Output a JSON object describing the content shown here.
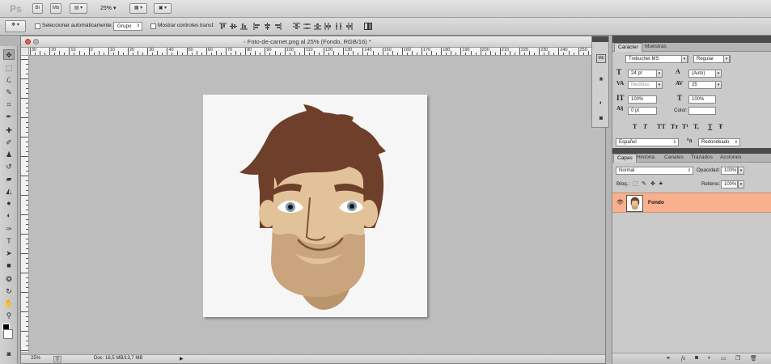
{
  "app": {
    "logo": "Ps"
  },
  "menubar": {
    "btn_br": "Br",
    "btn_mb": "Mb",
    "zoom": "25%"
  },
  "options": {
    "auto_select_label": "Seleccionar automáticamente:",
    "auto_select_value": "Grupo",
    "show_transform_label": "Mostrar controles transf."
  },
  "document": {
    "title": "Foto-de-carnet.png al 25% (Fondo, RGB/16) *",
    "ruler_labels": [
      "30",
      "20",
      "10",
      "0",
      "10",
      "20",
      "30",
      "40",
      "50",
      "60",
      "70",
      "80",
      "90",
      "100",
      "110",
      "120",
      "130",
      "140",
      "150",
      "160",
      "170",
      "180",
      "190",
      "200",
      "210",
      "220",
      "230",
      "240",
      "250"
    ],
    "status_zoom": "25%",
    "status_doc": "Doc: 16,5 MB/13,7 MB"
  },
  "character_panel": {
    "tabs": [
      "Carácter",
      "Muestras"
    ],
    "font_family": "Trebuchet MS",
    "font_style": "Regular",
    "font_size": "24 pt",
    "leading": "(Auto)",
    "kerning": "Medidas",
    "tracking": "25",
    "vscale": "100%",
    "hscale": "100%",
    "baseline": "0 pt",
    "color_label": "Color:",
    "type_buttons": [
      "T",
      "T",
      "TT",
      "Tт",
      "T¹",
      "T,",
      "T",
      "Ŧ"
    ],
    "language": "Español",
    "aa_label": "ªa",
    "antialias": "Redondeado"
  },
  "layers_panel": {
    "tabs": [
      "Capas",
      "Historia",
      "Canales",
      "Trazados",
      "Acciones"
    ],
    "blend_mode": "Normal",
    "opacity_label": "Opacidad:",
    "opacity": "100%",
    "lock_label": "Bloq.:",
    "fill_label": "Relleno:",
    "fill": "100%",
    "layer_name": "Fondo"
  },
  "colors": {
    "selected_layer": "#f9b08d",
    "hair": "#6e3f2a",
    "skin": "#e2c299",
    "beard": "#caa47c",
    "chin": "#b8956a"
  }
}
